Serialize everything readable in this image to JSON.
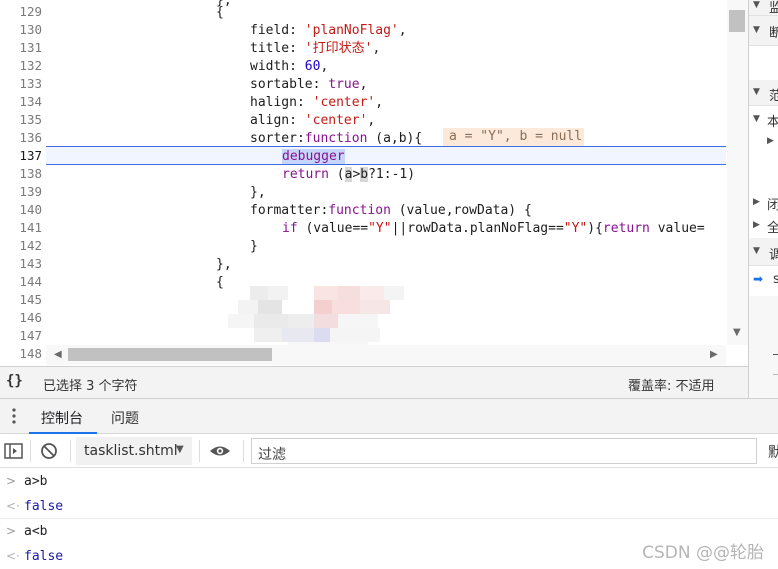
{
  "editor": {
    "line_numbers": [
      "129",
      "130",
      "131",
      "132",
      "133",
      "134",
      "135",
      "136",
      "137",
      "138",
      "139",
      "140",
      "141",
      "142",
      "143",
      "144",
      "145",
      "146",
      "147",
      "148"
    ],
    "active_line": "137",
    "code": {
      "l129": "},",
      "l130": "{",
      "l131_key": "field: ",
      "l131_val": "'planNoFlag'",
      "l131_end": ",",
      "l132_key": "title: ",
      "l132_val": "'打印状态'",
      "l132_end": ",",
      "l133_key": "width: ",
      "l133_val": "60",
      "l133_end": ",",
      "l134_key": "sortable: ",
      "l134_val": "true",
      "l134_end": ",",
      "l135_key": "halign: ",
      "l135_val": "'center'",
      "l135_end": ",",
      "l136_key": "align: ",
      "l136_val": "'center'",
      "l136_end": ",",
      "l137_key": "sorter:",
      "l137_fn": "function",
      "l137_args": " (a,b){",
      "l137_inline": "a = \"Y\", b = null",
      "l138": "debugger",
      "l139_kw": "return",
      "l139_open": " (",
      "l139_a": "a",
      "l139_gt": ">",
      "l139_b": "b",
      "l139_rest": "?1:-1)",
      "l140": "},",
      "l141_key": "formatter:",
      "l141_fn": "function",
      "l141_args": " (value,rowData) {",
      "l142_kw": "if",
      "l142_p1": " (value==",
      "l142_s1": "\"Y\"",
      "l142_p2": "||rowData.planNoFlag==",
      "l142_s2": "\"Y\"",
      "l142_p3": "){",
      "l142_ret": "return",
      "l142_tail": " value=",
      "l143": "}",
      "l144": "},",
      "l145": "{"
    }
  },
  "status_bar": {
    "braces": "{}",
    "selection": "已选择 3 个字符",
    "coverage": "覆盖率: 不适用"
  },
  "right_panel": {
    "items": [
      "监",
      "断",
      "范",
      "本",
      "闭",
      "全",
      "调",
      "s"
    ]
  },
  "drawer": {
    "tabs": [
      "控制台",
      "问题"
    ],
    "active_tab": "控制台"
  },
  "console_toolbar": {
    "context": "tasklist.shtml",
    "filter_placeholder": "过滤",
    "default_levels": "默"
  },
  "console": {
    "entries": [
      {
        "type": "input",
        "text": "a>b"
      },
      {
        "type": "output",
        "text": "false"
      },
      {
        "type": "input",
        "text": "a<b"
      },
      {
        "type": "output",
        "text": "false"
      }
    ]
  },
  "watermark": "CSDN @@轮胎",
  "colors": {
    "keyword": "#881391",
    "string": "#c41a16",
    "number": "#1c00cf",
    "accent": "#1a73e8",
    "exec_line_border": "#3b6ee6"
  }
}
